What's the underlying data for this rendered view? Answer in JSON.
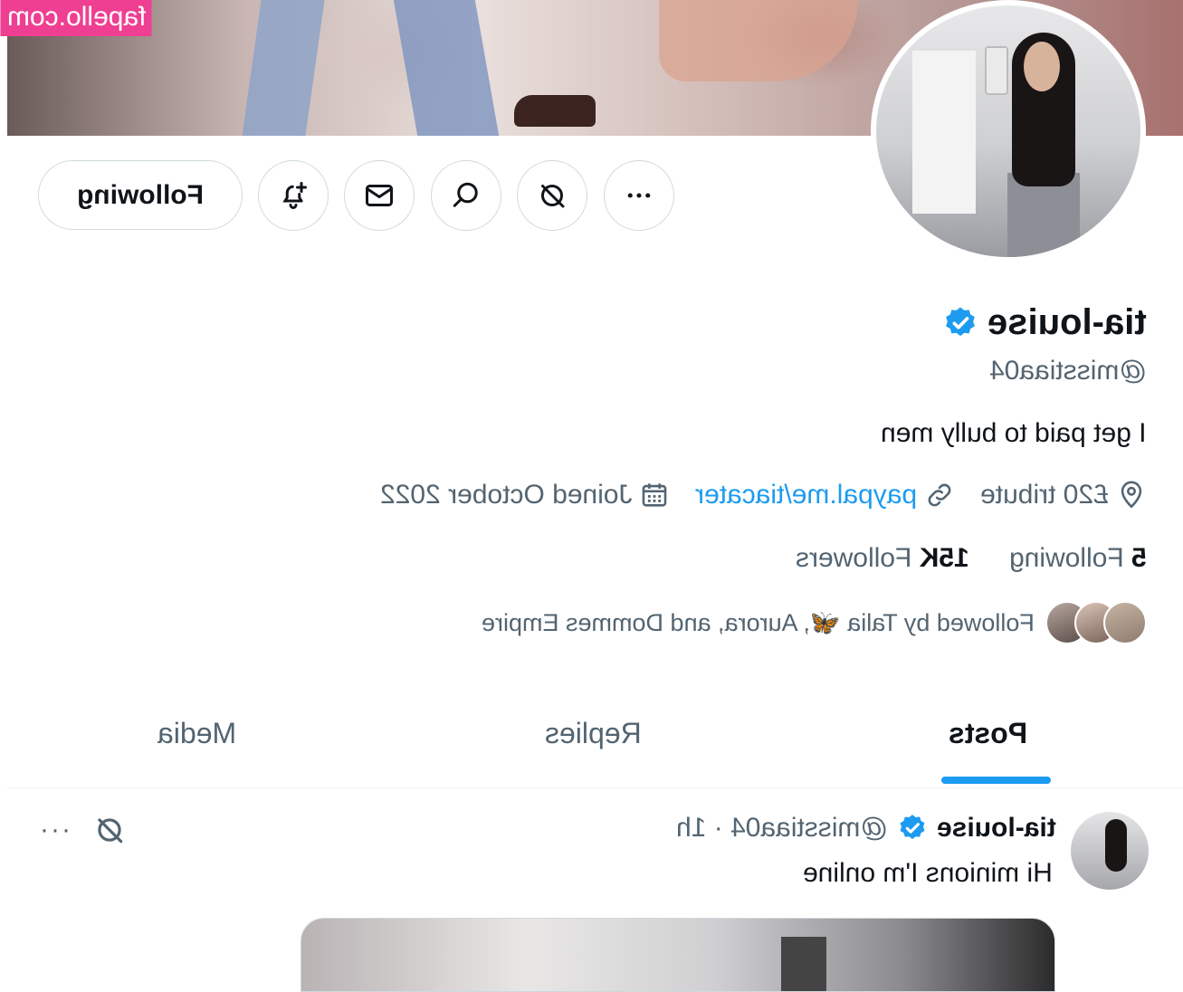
{
  "watermark": "fapello.com",
  "profile": {
    "name": "tia-louise",
    "handle": "@misstiaa04",
    "bio": "I get paid to bully men",
    "location": "£20 tribute",
    "website": "paypal.me/tiacater",
    "joined": "Joined October 2022",
    "following_count": "5",
    "following_label": "Following",
    "followers_count": "15K",
    "followers_label": "Followers",
    "followed_by": "Followed by Talia 🦋, Aurora, and Dommes Empire"
  },
  "actions": {
    "following_button": "Following",
    "icons": [
      "more-icon",
      "grok-icon",
      "search-icon",
      "mail-icon",
      "notification-add-icon"
    ]
  },
  "tabs": [
    {
      "label": "Posts",
      "active": true
    },
    {
      "label": "Replies",
      "active": false
    },
    {
      "label": "Media",
      "active": false
    }
  ],
  "post": {
    "name": "tia-louise",
    "handle_time": "@misstiaa04 · 1h",
    "text": "Hi minions I'm online",
    "more": "···"
  },
  "colors": {
    "accent": "#1d9bf0",
    "watermark_bg": "#ef3f92",
    "muted_text": "#536471"
  }
}
